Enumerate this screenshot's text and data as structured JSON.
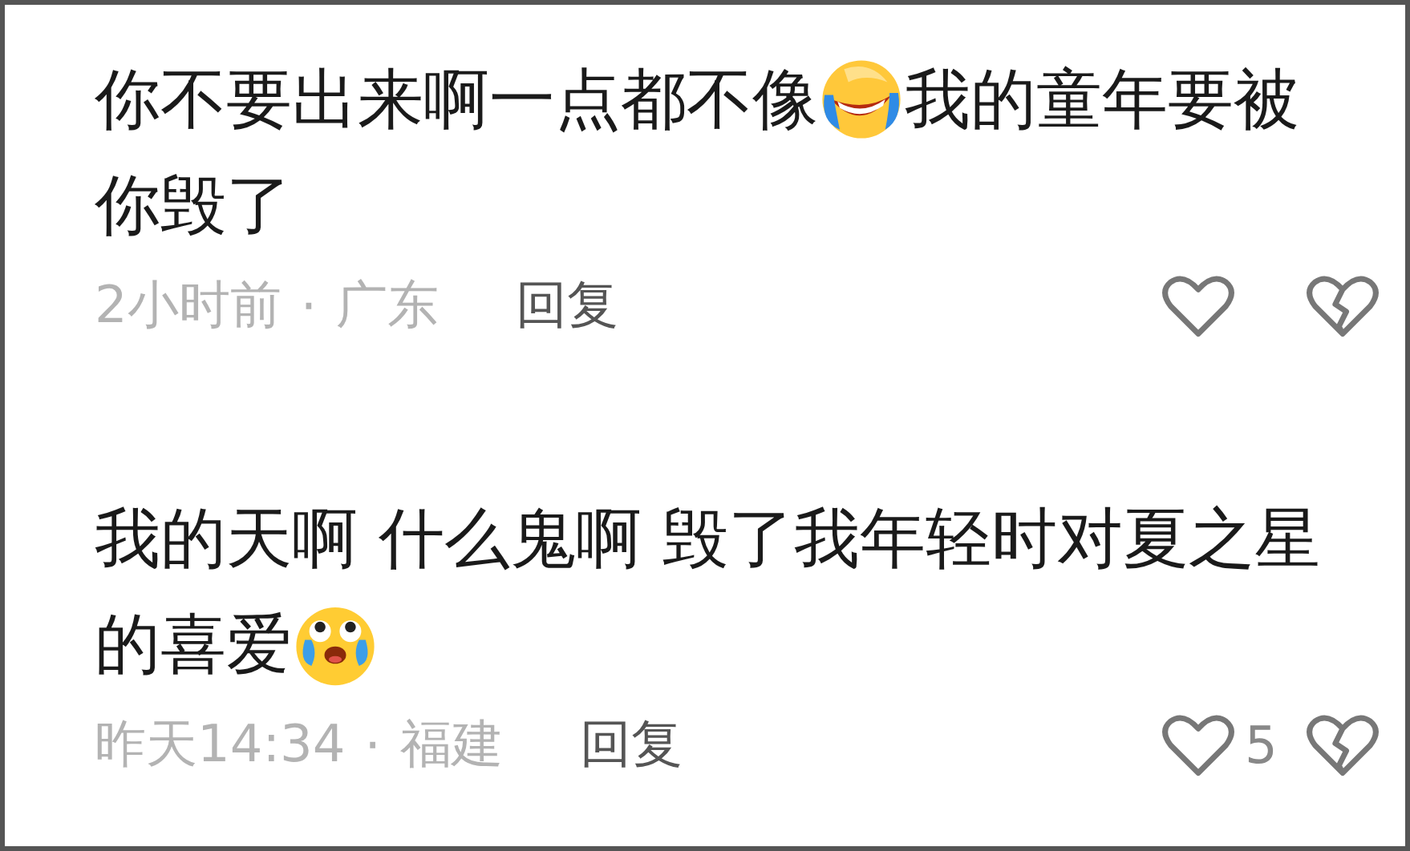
{
  "comments": [
    {
      "lines": [
        [
          {
            "kind": "text",
            "text": "你不要出来啊一点都不像"
          },
          {
            "kind": "laughing_emoji"
          },
          {
            "kind": "text",
            "text": "我的童年要被"
          }
        ],
        [
          {
            "kind": "text",
            "text": "你毁了"
          }
        ]
      ],
      "time": "2小时前",
      "separator": "·",
      "location": "广东",
      "reply": "回复"
    },
    {
      "lines": [
        [
          {
            "kind": "text",
            "text": "我的天啊 什么鬼啊 毁了我年轻时对夏之星"
          }
        ],
        [
          {
            "kind": "text",
            "text": "的喜爱"
          },
          {
            "kind": "crying_emoji"
          }
        ]
      ],
      "time": "昨天14:34",
      "separator": "·",
      "location": "福建",
      "reply": "回复",
      "likes": "5"
    }
  ]
}
